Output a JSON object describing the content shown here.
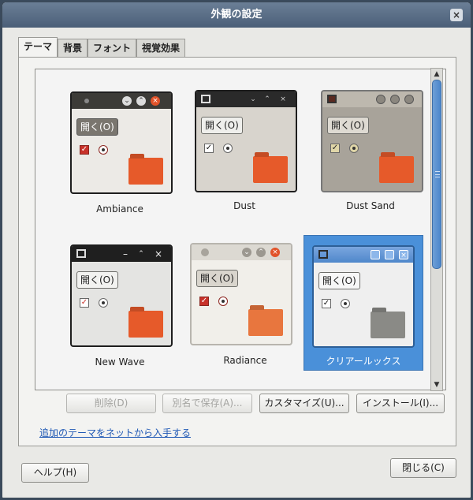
{
  "window": {
    "title": "外観の設定",
    "close_glyph": "×"
  },
  "tabs": [
    {
      "label": "テーマ"
    },
    {
      "label": "背景"
    },
    {
      "label": "フォント"
    },
    {
      "label": "視覚効果"
    }
  ],
  "themes": [
    {
      "name": "Ambiance",
      "button_label": "開く(O)"
    },
    {
      "name": "Dust",
      "button_label": "開く(O)"
    },
    {
      "name": "Dust Sand",
      "button_label": "開く(O)"
    },
    {
      "name": "New Wave",
      "button_label": "開く(O)"
    },
    {
      "name": "Radiance",
      "button_label": "開く(O)"
    },
    {
      "name": "クリアールックス",
      "button_label": "開く(O)",
      "selected": true
    }
  ],
  "actions": {
    "delete": "削除(D)",
    "save_as": "別名で保存(A)...",
    "customize": "カスタマイズ(U)...",
    "install": "インストール(I)..."
  },
  "link": "追加のテーマをネットから入手する",
  "footer": {
    "help": "ヘルプ(H)",
    "close": "閉じる(C)"
  },
  "glyphs": {
    "check": "✓",
    "up": "▲",
    "down": "▼"
  },
  "colors": {
    "selection": "#4a90d9",
    "folder_orange": "#e65a2a",
    "link": "#1f58b5"
  }
}
